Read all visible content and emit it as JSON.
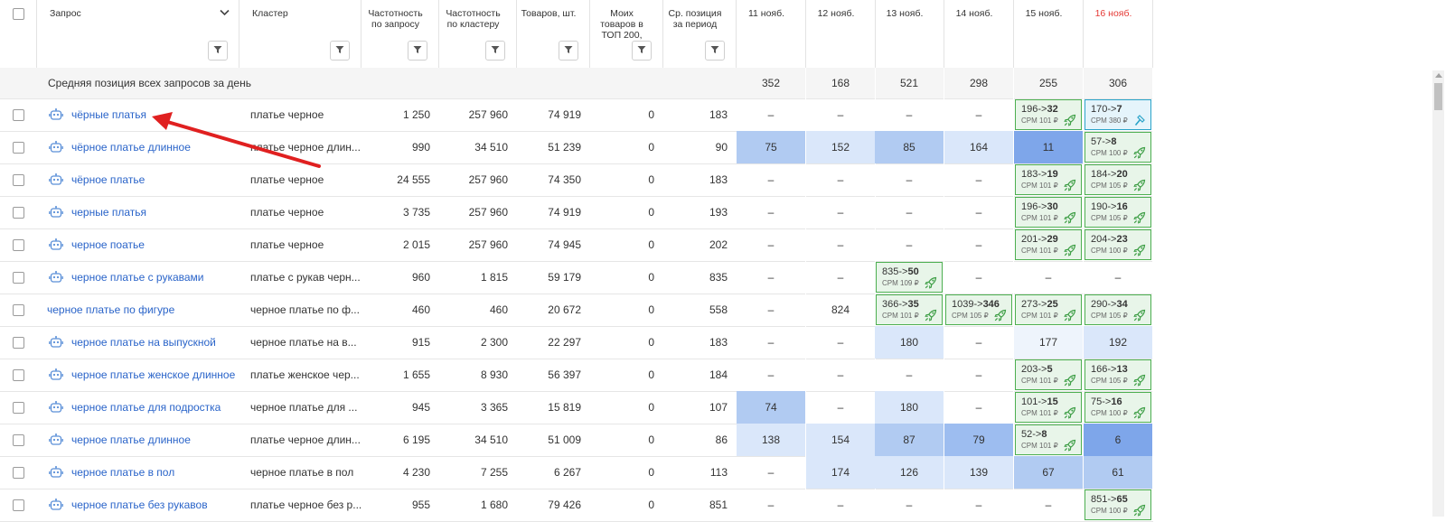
{
  "headers": {
    "query": "Запрос",
    "cluster": "Кластер",
    "freq_query": "Частотность по запросу",
    "freq_cluster": "Частотность по кластеру",
    "goods": "Товаров, шт.",
    "my_goods": "Моих товаров в ТОП 200,",
    "avg_pos": "Ср. позиция за период",
    "dates": [
      "11 нояб.",
      "12 нояб.",
      "13 нояб.",
      "14 нояб.",
      "15 нояб.",
      "16 нояб."
    ]
  },
  "avg_row": {
    "label": "Средняя позиция всех запросов за день",
    "values": [
      "352",
      "168",
      "521",
      "298",
      "255",
      "306"
    ]
  },
  "colors": {
    "link": "#2a64c9",
    "date_today": "#e53935",
    "arrow": "#e02020",
    "boost_border": "#4caf50",
    "boost_bg": "#e8f5e9"
  },
  "rows": [
    {
      "query": "чёрные платья",
      "bot": true,
      "cluster": "платье черное",
      "fq": "1 250",
      "fc": "257 960",
      "goods": "74 919",
      "my": "0",
      "avg": "183",
      "days": [
        {
          "t": "–"
        },
        {
          "t": "–"
        },
        {
          "t": "–"
        },
        {
          "t": "–"
        },
        {
          "from": "196->",
          "to": "32",
          "cpm": "CPM 101 ₽"
        },
        {
          "from": "170->",
          "to": "7",
          "cpm": "CPM 380 ₽",
          "blue": true
        }
      ]
    },
    {
      "query": "чёрное платье длинное",
      "bot": true,
      "cluster": "платье черное длин...",
      "fq": "990",
      "fc": "34 510",
      "goods": "51 239",
      "my": "0",
      "avg": "90",
      "days": [
        {
          "t": "75",
          "h": "#b1cbf2"
        },
        {
          "t": "152",
          "h": "#dae7fa"
        },
        {
          "t": "85",
          "h": "#b1cbf2"
        },
        {
          "t": "164",
          "h": "#dae7fa"
        },
        {
          "t": "11",
          "h": "#7ea6ea"
        },
        {
          "from": "57->",
          "to": "8",
          "cpm": "CPM 100 ₽"
        }
      ]
    },
    {
      "query": "чёрное платье",
      "bot": true,
      "cluster": "платье черное",
      "fq": "24 555",
      "fc": "257 960",
      "goods": "74 350",
      "my": "0",
      "avg": "183",
      "days": [
        {
          "t": "–"
        },
        {
          "t": "–"
        },
        {
          "t": "–"
        },
        {
          "t": "–"
        },
        {
          "from": "183->",
          "to": "19",
          "cpm": "CPM 101 ₽"
        },
        {
          "from": "184->",
          "to": "20",
          "cpm": "CPM 105 ₽"
        }
      ]
    },
    {
      "query": "черные платья",
      "bot": true,
      "cluster": "платье черное",
      "fq": "3 735",
      "fc": "257 960",
      "goods": "74 919",
      "my": "0",
      "avg": "193",
      "days": [
        {
          "t": "–"
        },
        {
          "t": "–"
        },
        {
          "t": "–"
        },
        {
          "t": "–"
        },
        {
          "from": "196->",
          "to": "30",
          "cpm": "CPM 101 ₽"
        },
        {
          "from": "190->",
          "to": "16",
          "cpm": "CPM 105 ₽"
        }
      ]
    },
    {
      "query": "черное поатье",
      "bot": true,
      "cluster": "платье черное",
      "fq": "2 015",
      "fc": "257 960",
      "goods": "74 945",
      "my": "0",
      "avg": "202",
      "days": [
        {
          "t": "–"
        },
        {
          "t": "–"
        },
        {
          "t": "–"
        },
        {
          "t": "–"
        },
        {
          "from": "201->",
          "to": "29",
          "cpm": "CPM 101 ₽"
        },
        {
          "from": "204->",
          "to": "23",
          "cpm": "CPM 100 ₽"
        }
      ]
    },
    {
      "query": "черное платье с рукавами",
      "bot": true,
      "cluster": "платье с рукав черн...",
      "fq": "960",
      "fc": "1 815",
      "goods": "59 179",
      "my": "0",
      "avg": "835",
      "days": [
        {
          "t": "–"
        },
        {
          "t": "–"
        },
        {
          "from": "835->",
          "to": "50",
          "cpm": "CPM 109 ₽"
        },
        {
          "t": "–"
        },
        {
          "t": "–"
        },
        {
          "t": "–"
        }
      ]
    },
    {
      "query": "черное платье по фигуре",
      "bot": false,
      "cluster": "черное платье по ф...",
      "fq": "460",
      "fc": "460",
      "goods": "20 672",
      "my": "0",
      "avg": "558",
      "days": [
        {
          "t": "–"
        },
        {
          "t": "824"
        },
        {
          "from": "366->",
          "to": "35",
          "cpm": "CPM 101 ₽"
        },
        {
          "from": "1039->",
          "to": "346",
          "cpm": "CPM 105 ₽"
        },
        {
          "from": "273->",
          "to": "25",
          "cpm": "CPM 101 ₽"
        },
        {
          "from": "290->",
          "to": "34",
          "cpm": "CPM 105 ₽"
        }
      ]
    },
    {
      "query": "черное платье на выпускной",
      "bot": true,
      "cluster": "черное платье на в...",
      "fq": "915",
      "fc": "2 300",
      "goods": "22 297",
      "my": "0",
      "avg": "183",
      "days": [
        {
          "t": "–"
        },
        {
          "t": "–"
        },
        {
          "t": "180",
          "h": "#dae7fa"
        },
        {
          "t": "–"
        },
        {
          "t": "177",
          "h": "#eef4fc"
        },
        {
          "t": "192",
          "h": "#dae7fa"
        }
      ]
    },
    {
      "query": "черное платье женское длинное",
      "bot": true,
      "cluster": "платье женское чер...",
      "fq": "1 655",
      "fc": "8 930",
      "goods": "56 397",
      "my": "0",
      "avg": "184",
      "days": [
        {
          "t": "–"
        },
        {
          "t": "–"
        },
        {
          "t": "–"
        },
        {
          "t": "–"
        },
        {
          "from": "203->",
          "to": "5",
          "cpm": "CPM 101 ₽"
        },
        {
          "from": "166->",
          "to": "13",
          "cpm": "CPM 105 ₽"
        }
      ]
    },
    {
      "query": "черное платье для подростка",
      "bot": true,
      "cluster": "черное платье для ...",
      "fq": "945",
      "fc": "3 365",
      "goods": "15 819",
      "my": "0",
      "avg": "107",
      "days": [
        {
          "t": "74",
          "h": "#b1cbf2"
        },
        {
          "t": "–"
        },
        {
          "t": "180",
          "h": "#dae7fa"
        },
        {
          "t": "–"
        },
        {
          "from": "101->",
          "to": "15",
          "cpm": "CPM 101 ₽"
        },
        {
          "from": "75->",
          "to": "16",
          "cpm": "CPM 100 ₽"
        }
      ]
    },
    {
      "query": "черное платье длинное",
      "bot": true,
      "cluster": "платье черное длин...",
      "fq": "6 195",
      "fc": "34 510",
      "goods": "51 009",
      "my": "0",
      "avg": "86",
      "days": [
        {
          "t": "138",
          "h": "#dae7fa"
        },
        {
          "t": "154",
          "h": "#dae7fa"
        },
        {
          "t": "87",
          "h": "#b1cbf2"
        },
        {
          "t": "79",
          "h": "#9dbdf0"
        },
        {
          "from": "52->",
          "to": "8",
          "cpm": "CPM 101 ₽"
        },
        {
          "t": "6",
          "h": "#7ea6ea"
        }
      ]
    },
    {
      "query": "черное платье в пол",
      "bot": true,
      "cluster": "черное платье в пол",
      "fq": "4 230",
      "fc": "7 255",
      "goods": "6 267",
      "my": "0",
      "avg": "113",
      "days": [
        {
          "t": "–"
        },
        {
          "t": "174",
          "h": "#dae7fa"
        },
        {
          "t": "126",
          "h": "#dae7fa"
        },
        {
          "t": "139",
          "h": "#dae7fa"
        },
        {
          "t": "67",
          "h": "#b1cbf2"
        },
        {
          "t": "61",
          "h": "#b1cbf2"
        }
      ]
    },
    {
      "query": "черное платье без рукавов",
      "bot": true,
      "cluster": "платье черное без р...",
      "fq": "955",
      "fc": "1 680",
      "goods": "79 426",
      "my": "0",
      "avg": "851",
      "days": [
        {
          "t": "–"
        },
        {
          "t": "–"
        },
        {
          "t": "–"
        },
        {
          "t": "–"
        },
        {
          "t": "–"
        },
        {
          "from": "851->",
          "to": "65",
          "cpm": "CPM 100 ₽"
        }
      ]
    }
  ]
}
